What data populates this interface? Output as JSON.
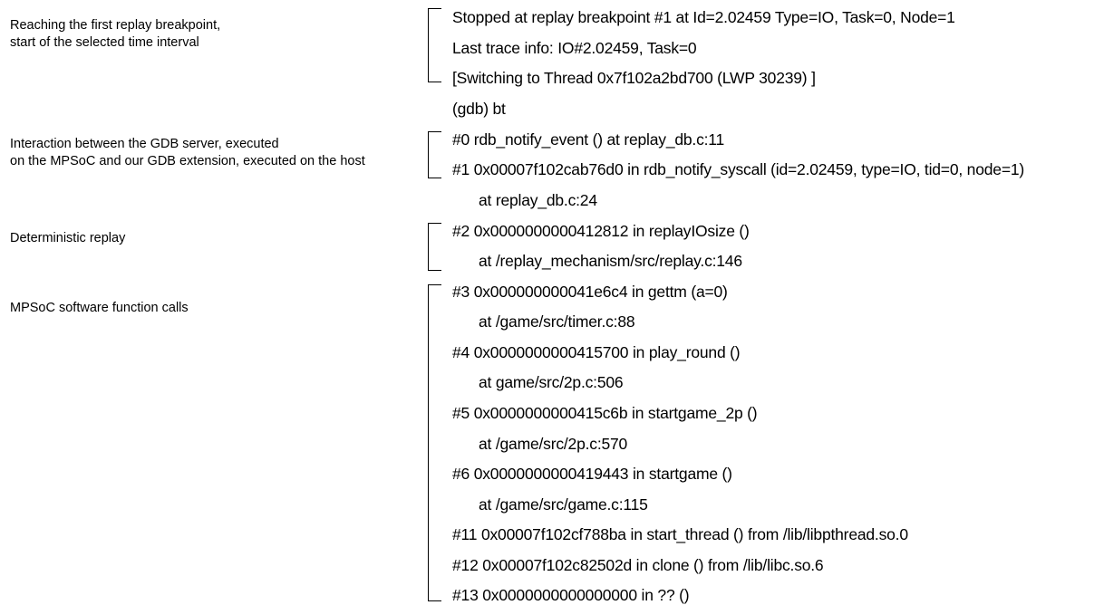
{
  "annotations": [
    {
      "lines": [
        "Reaching the first replay breakpoint,",
        "start of the selected time interval"
      ]
    },
    {
      "lines": [
        "Interaction between the GDB server, executed",
        "on the MPSoC and our GDB extension, executed on the host"
      ]
    },
    {
      "lines": [
        "Deterministic replay"
      ]
    },
    {
      "lines": [
        "MPSoC software function calls"
      ]
    }
  ],
  "gdb_output": [
    "Stopped at replay breakpoint #1 at Id=2.02459 Type=IO, Task=0, Node=1",
    "Last trace info: IO#2.02459, Task=0",
    "[Switching to Thread 0x7f102a2bd700 (LWP 30239) ]",
    "(gdb)  bt",
    "#0   rdb_notify_event ()  at replay_db.c:11",
    "#1   0x00007f102cab76d0 in rdb_notify_syscall (id=2.02459, type=IO, tid=0, node=1)",
    "at replay_db.c:24",
    "#2   0x0000000000412812 in replayIOsize ()",
    "at /replay_mechanism/src/replay.c:146",
    "#3   0x000000000041e6c4 in gettm (a=0)",
    "at /game/src/timer.c:88",
    "#4   0x0000000000415700 in play_round ()",
    "at game/src/2p.c:506",
    "#5   0x0000000000415c6b in startgame_2p ()",
    "at /game/src/2p.c:570",
    "#6   0x0000000000419443 in startgame ()",
    "at /game/src/game.c:115",
    "#11 0x00007f102cf788ba in start_thread ()  from /lib/libpthread.so.0",
    "#12 0x00007f102c82502d in clone ()  from /lib/libc.so.6",
    "#13 0x0000000000000000 in ?? ()"
  ]
}
